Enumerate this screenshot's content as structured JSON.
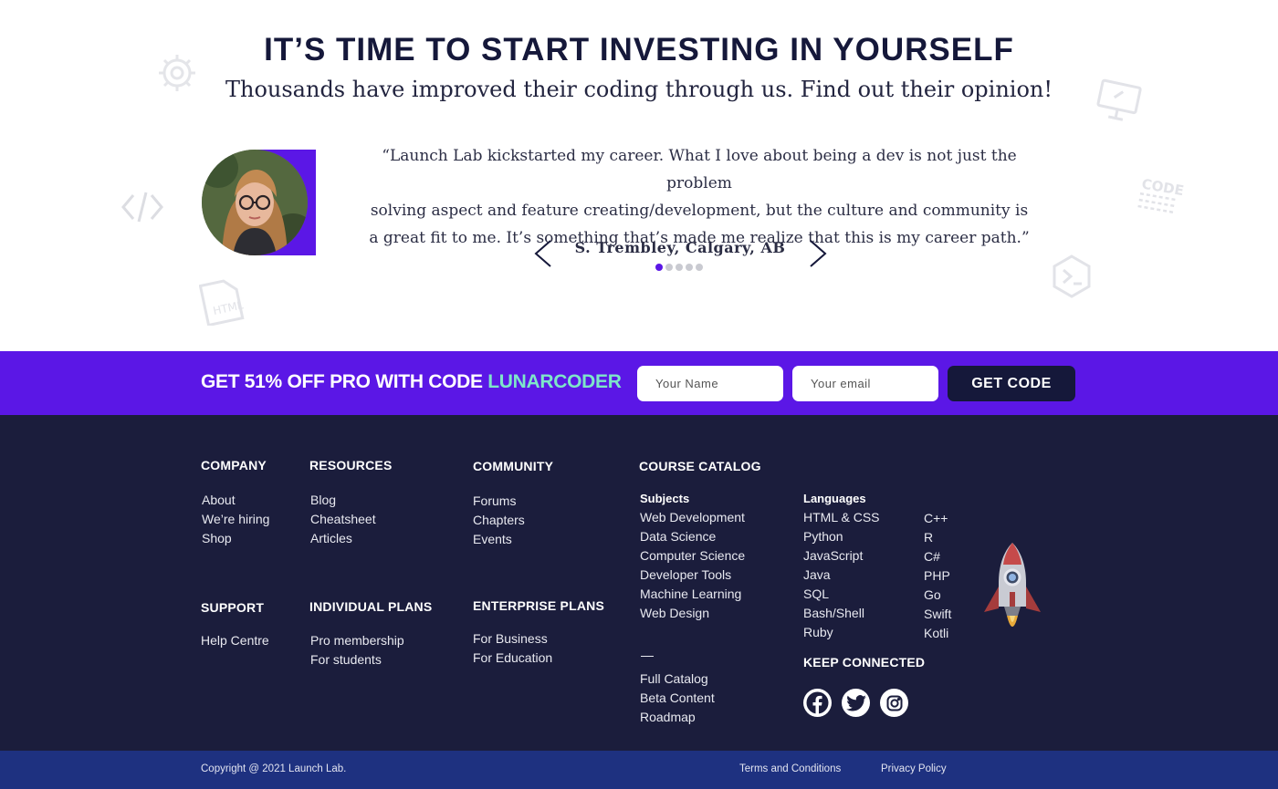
{
  "hero": {
    "title": "IT’S TIME TO START INVESTING IN YOURSELF",
    "subtitle": "Thousands have improved their coding through us. Find out their opinion!"
  },
  "testimonial": {
    "quote_lines": [
      "“Launch Lab kickstarted my career. What I love about being a dev is not just the problem",
      "solving aspect and feature creating/development, but the culture and community is",
      "a great fit to me. It’s something that’s made me realize that this is my career path.”"
    ],
    "author": "S. Trembley, Calgary, AB",
    "slide_count": 5,
    "active_slide": 1
  },
  "promo": {
    "text": "GET 51% OFF PRO WITH CODE",
    "code": "LUNARCODER",
    "name_placeholder": "Your Name",
    "email_placeholder": "Your email",
    "button": "GET CODE"
  },
  "footer": {
    "company": {
      "title": "COMPANY",
      "links": [
        "About",
        "We’re hiring",
        "Shop"
      ]
    },
    "resources": {
      "title": "RESOURCES",
      "links": [
        "Blog",
        "Cheatsheet",
        "Articles"
      ]
    },
    "community": {
      "title": "COMMUNITY",
      "links": [
        "Forums",
        "Chapters",
        "Events"
      ]
    },
    "support": {
      "title": "SUPPORT",
      "links": [
        "Help Centre"
      ]
    },
    "individual_plans": {
      "title": "INDIVIDUAL PLANS",
      "links": [
        "Pro membership",
        "For students"
      ]
    },
    "enterprise_plans": {
      "title": "ENTERPRISE PLANS",
      "links": [
        "For Business",
        "For Education"
      ]
    },
    "catalog": {
      "title": "COURSE CATALOG",
      "subjects_title": "Subjects",
      "subjects": [
        "Web Development",
        "Data Science",
        "Computer Science",
        "Developer Tools",
        "Machine Learning",
        "Web Design"
      ],
      "extra_links": [
        "Full Catalog",
        "Beta Content",
        "Roadmap"
      ],
      "languages_title": "Languages",
      "languages_1": [
        "HTML & CSS",
        "Python",
        "JavaScript",
        "Java",
        "SQL",
        "Bash/Shell",
        "Ruby"
      ],
      "languages_2": [
        "C++",
        "R",
        "C#",
        "PHP",
        "Go",
        "Swift",
        "Kotli"
      ]
    },
    "keep_connected": "KEEP CONNECTED"
  },
  "bottom": {
    "copyright": "Copyright @ 2021 Launch Lab.",
    "terms": "Terms and Conditions",
    "privacy": "Privacy Policy"
  },
  "colors": {
    "brand_purple": "#5b17e6",
    "promo_code": "#7ee6c9",
    "footer_bg": "#1b1d3c",
    "bottom_bg": "#1e3180",
    "heading": "#15183a"
  }
}
